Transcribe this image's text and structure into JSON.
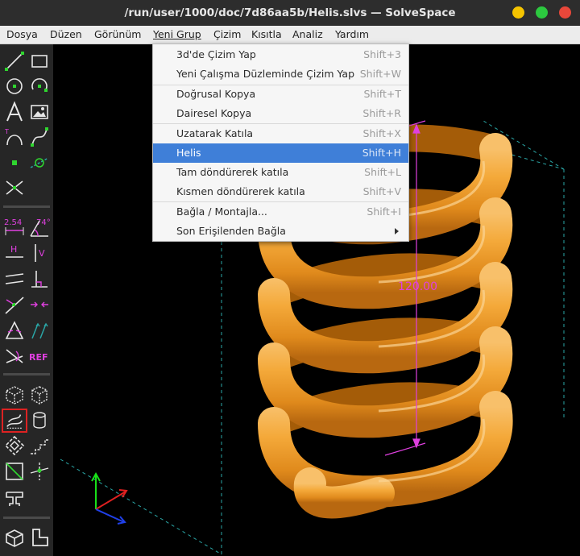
{
  "window": {
    "title": "/run/user/1000/doc/7d86aa5b/Helis.slvs — SolveSpace",
    "buttons": {
      "minimize": "#f5c400",
      "maximize": "#2cc83f",
      "close": "#e8473a"
    }
  },
  "menubar": {
    "items": [
      "Dosya",
      "Düzen",
      "Görünüm",
      "Yeni Grup",
      "Çizim",
      "Kısıtla",
      "Analiz",
      "Yardım"
    ],
    "active": "Yeni Grup"
  },
  "dropdown": {
    "items": [
      {
        "label": "3d'de Çizim Yap",
        "shortcut": "Shift+3"
      },
      {
        "label": "Yeni Çalışma Düzleminde Çizim Yap",
        "shortcut": "Shift+W"
      },
      {
        "label": "Doğrusal Kopya",
        "shortcut": "Shift+T"
      },
      {
        "label": "Dairesel Kopya",
        "shortcut": "Shift+R"
      },
      {
        "label": "Uzatarak Katıla",
        "shortcut": "Shift+X"
      },
      {
        "label": "Helis",
        "shortcut": "Shift+H"
      },
      {
        "label": "Tam döndürerek katıla",
        "shortcut": "Shift+L"
      },
      {
        "label": "Kısmen döndürerek katıla",
        "shortcut": "Shift+V"
      },
      {
        "label": "Bağla / Montajla...",
        "shortcut": "Shift+I"
      },
      {
        "label": "Son Erişilenden Bağla",
        "shortcut": ""
      }
    ],
    "highlighted": "Helis"
  },
  "toolbar": {
    "icons": [
      "line-tool",
      "rectangle-tool",
      "circle-tool",
      "arc-tool",
      "text-tool",
      "image-tool",
      "tangent-arc-tool",
      "spline-tool",
      "point-tool",
      "construction-tool",
      "split-curves-tool",
      "distance-constraint",
      "angle-constraint",
      "horizontal-constraint",
      "vertical-constraint",
      "parallel-constraint",
      "perpendicular-constraint",
      "point-on-line-constraint",
      "symmetric-constraint",
      "equal-constraint",
      "same-orientation-constraint",
      "other-supplementary-constraint",
      "reference-constraint",
      "nearest-isometric-view",
      "nearest-ortho-view",
      "helix-group",
      "revolve-group",
      "extrude-group",
      "linear-array-group",
      "step-translate",
      "step-rotate",
      "sketch-in-3d",
      "sketch-in-plane"
    ],
    "text_labels": {
      "dim": "2.54",
      "angle": "74°",
      "ref": "REF",
      "h": "H",
      "v": "V"
    }
  },
  "viewport": {
    "dimension_label": "120.00",
    "colors": {
      "spring": "#f4a93a",
      "dimension": "#e040e0",
      "construction": "#2aa6a6"
    }
  }
}
